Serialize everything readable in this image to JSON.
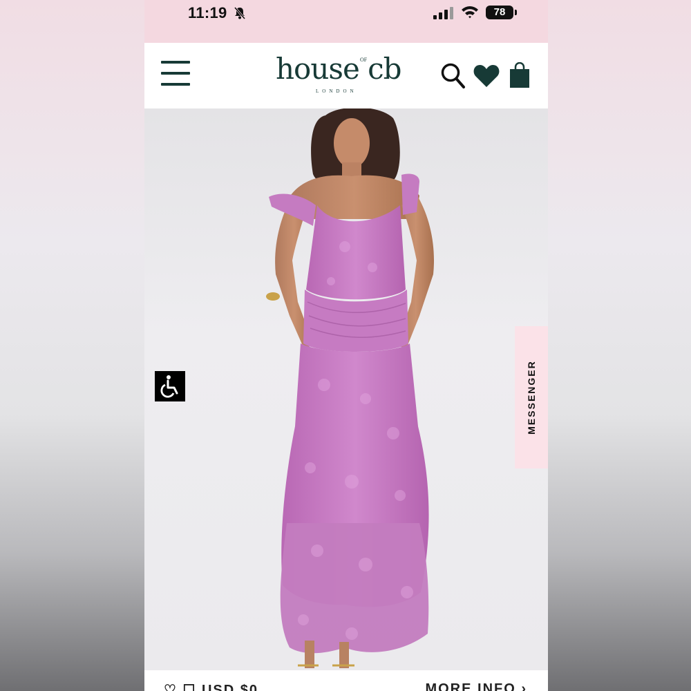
{
  "status_bar": {
    "time": "11:19",
    "battery": "78"
  },
  "header": {
    "logo_main": "house cb",
    "logo_of": "OF",
    "logo_sub": "LONDON",
    "icons": [
      "menu-icon",
      "search-icon",
      "heart-icon",
      "shopping-bag-icon"
    ]
  },
  "product": {
    "image_icon": "dress-photo",
    "colors": {
      "dress": "#c87ac4",
      "background": "#eae9ec"
    }
  },
  "accessibility": {
    "icon": "wheelchair-icon"
  },
  "messenger": {
    "label": "MESSENGER"
  },
  "bottom_bar": {
    "left_text": "♡ ☐  USD $0",
    "right_text": "MORE INFO ›"
  },
  "colors": {
    "brand": "#173a36",
    "status_bar_bg": "#f4d8e0",
    "messenger_bg": "#fbe2e8"
  }
}
